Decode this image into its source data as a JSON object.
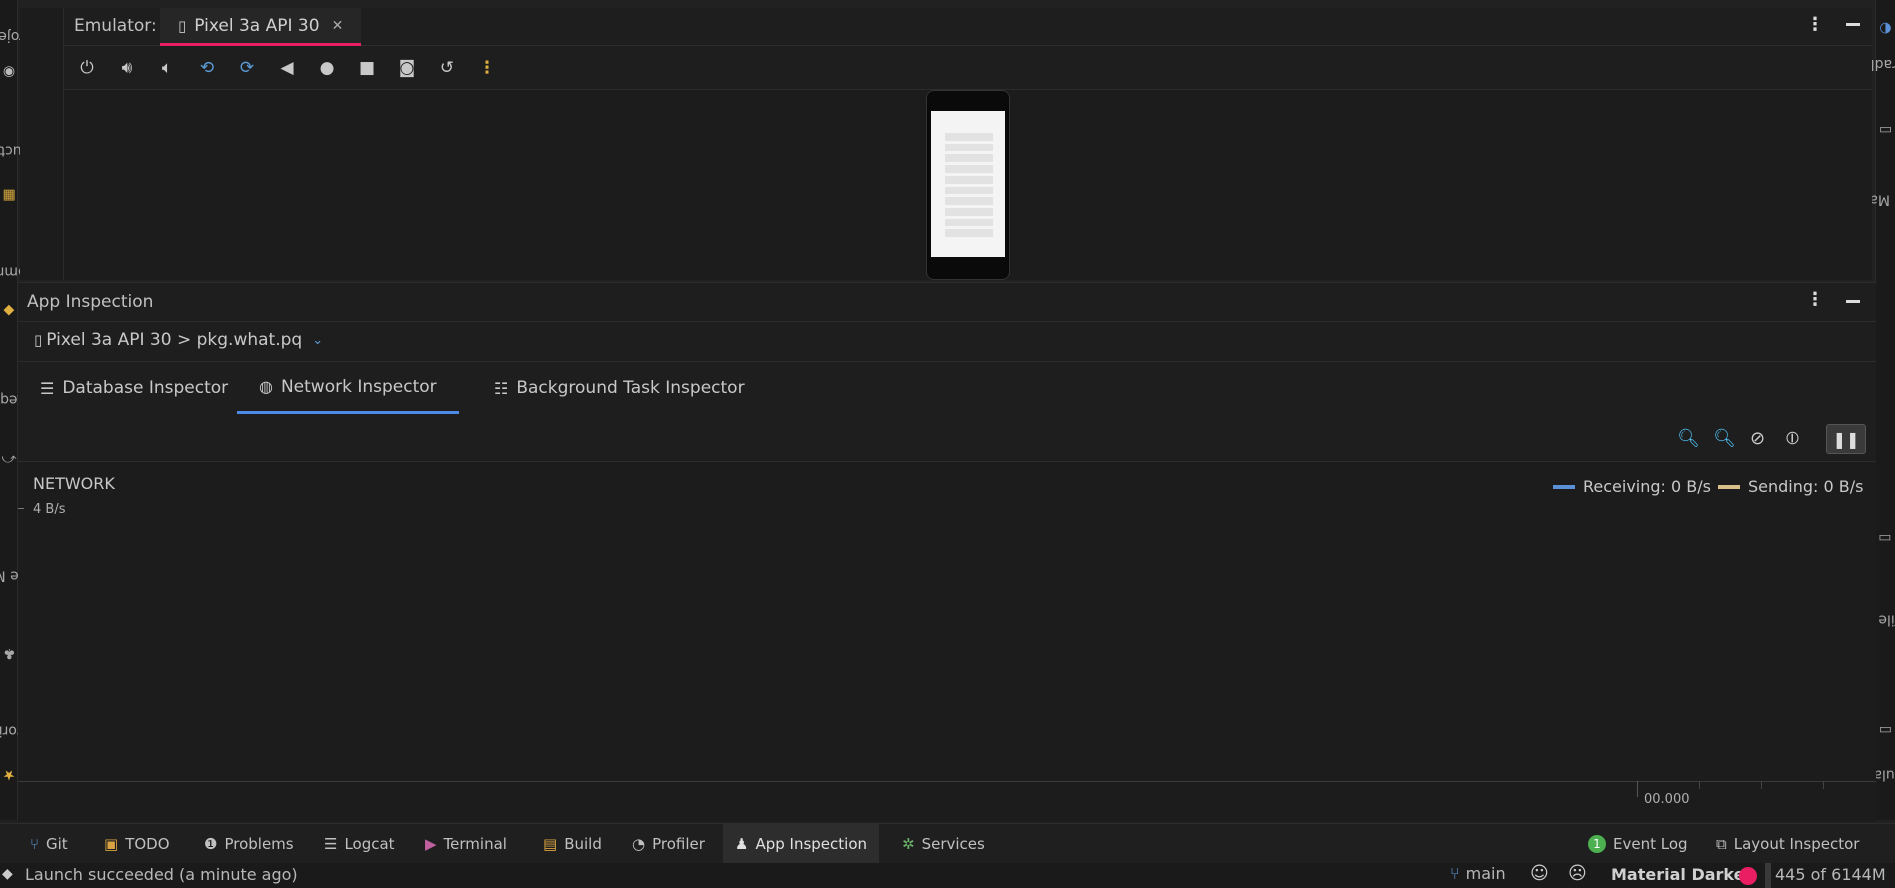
{
  "left_sidebar": {
    "project": "Project",
    "structure": "Structure",
    "commit": "Commit",
    "pull_requests": "Pull Requests",
    "resource_manager": "Resource Manager",
    "favorites": "Favorites"
  },
  "right_sidebar": {
    "gradle": "Gradle",
    "device_manager": "Device Manager",
    "device_file_explorer": "Device File Explorer",
    "emulator": "Emulator"
  },
  "emulator": {
    "label": "Emulator:",
    "tab_title": "Pixel 3a API 30",
    "close": "✕"
  },
  "app_inspection": {
    "title": "App Inspection",
    "device_selector": "Pixel 3a API 30 > pkg.what.pq",
    "tabs": [
      {
        "label": "Database Inspector"
      },
      {
        "label": "Network Inspector"
      },
      {
        "label": "Background Task Inspector"
      }
    ]
  },
  "network": {
    "title": "NETWORK",
    "scale": "4 B/s",
    "receiving": "Receiving: 0 B/s",
    "sending": "Sending: 0 B/s",
    "time_label": "00.000",
    "receiving_color": "#5b8fd6",
    "sending_color": "#d9c08a"
  },
  "bottom_tabs": {
    "git": "Git",
    "todo": "TODO",
    "problems": "Problems",
    "logcat": "Logcat",
    "terminal": "Terminal",
    "build": "Build",
    "profiler": "Profiler",
    "app_inspection": "App Inspection",
    "services": "Services",
    "event_log_count": "1",
    "event_log": "Event Log",
    "layout_inspector": "Layout Inspector"
  },
  "status": {
    "message": "Launch succeeded (a minute ago)",
    "branch": "main",
    "theme": "Material Darker",
    "memory": "445 of 6144M"
  }
}
